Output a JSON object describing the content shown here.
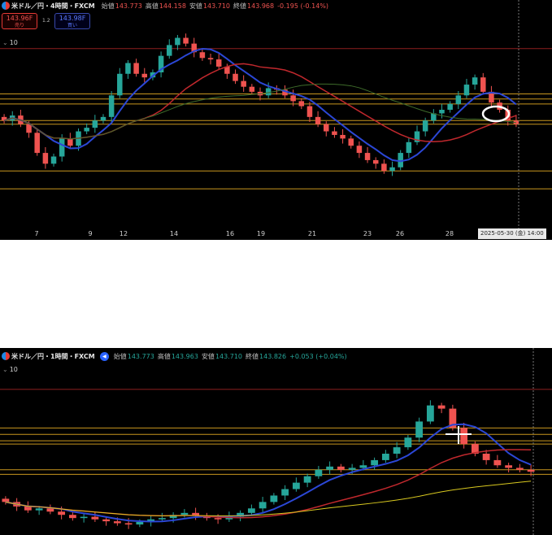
{
  "top_chart": {
    "symbol": "米ドル／円・4時間・FXCM",
    "ohlc": [
      {
        "label": "始値",
        "value": "143.773"
      },
      {
        "label": "高値",
        "value": "144.158"
      },
      {
        "label": "安値",
        "value": "143.710"
      },
      {
        "label": "終値",
        "value": "143.968"
      }
    ],
    "change": "-0.195 (-0.14%)",
    "sell_price": "143.96F",
    "sell_label": "売り",
    "spread": "1.2",
    "buy_price": "143.98F",
    "buy_label": "買い",
    "volume_label": "10",
    "date_tag": "2025-05-30 (金)   14:00",
    "x_ticks": [
      "7",
      "9",
      "12",
      "14",
      "16",
      "19",
      "21",
      "23",
      "26",
      "28"
    ]
  },
  "bottom_chart": {
    "symbol": "米ドル／円・1時間・FXCM",
    "ohlc": [
      {
        "label": "始値",
        "value": "143.773"
      },
      {
        "label": "高値",
        "value": "143.963"
      },
      {
        "label": "安値",
        "value": "143.710"
      },
      {
        "label": "終値",
        "value": "143.826"
      }
    ],
    "change": "+0.053 (+0.04%)",
    "volume_label": "10"
  },
  "colors": {
    "up": "#26a69a",
    "down": "#ef5350",
    "ma_short": "#2b47d6",
    "ma_mid": "#c0282d",
    "ma_long": "#3e6b2a",
    "ma_yellow": "#d8c81f",
    "hline_orange": "#c8961e",
    "hline_red": "#8e1f1f"
  },
  "chart_data": [
    {
      "type": "candlestick",
      "title": "米ドル／円・4時間・FXCM",
      "x_ticks": [
        "7",
        "9",
        "12",
        "14",
        "16",
        "19",
        "21",
        "23",
        "26",
        "28"
      ],
      "ylim": [
        142.4,
        145.0
      ],
      "close": [
        143.55,
        143.62,
        143.5,
        143.38,
        143.1,
        142.95,
        143.05,
        143.3,
        143.2,
        143.4,
        143.45,
        143.55,
        143.6,
        143.9,
        144.2,
        144.35,
        144.2,
        144.15,
        144.22,
        144.45,
        144.6,
        144.7,
        144.62,
        144.5,
        144.42,
        144.4,
        144.3,
        144.2,
        144.1,
        144.02,
        143.95,
        143.9,
        144.0,
        143.98,
        143.9,
        143.82,
        143.75,
        143.6,
        143.5,
        143.4,
        143.35,
        143.3,
        143.2,
        143.1,
        143.0,
        142.95,
        142.85,
        142.9,
        143.1,
        143.25,
        143.4,
        143.55,
        143.65,
        143.7,
        143.78,
        143.9,
        144.05,
        144.15,
        143.95,
        143.8,
        143.7,
        143.55,
        143.5
      ],
      "horizontal_levels": [
        144.55,
        143.92,
        143.85,
        143.78,
        143.55,
        143.5,
        142.85,
        142.6
      ],
      "annotation": "circle at recent high"
    },
    {
      "type": "candlestick",
      "title": "米ドル／円・1時間・FXCM",
      "ylim": [
        142.6,
        145.0
      ],
      "close": [
        143.05,
        142.98,
        142.92,
        142.95,
        142.9,
        142.85,
        142.8,
        142.82,
        142.78,
        142.75,
        142.72,
        142.7,
        142.74,
        142.78,
        142.8,
        142.85,
        142.88,
        142.84,
        142.8,
        142.78,
        142.82,
        142.88,
        142.95,
        143.05,
        143.15,
        143.25,
        143.35,
        143.45,
        143.55,
        143.6,
        143.55,
        143.58,
        143.62,
        143.7,
        143.8,
        143.9,
        144.05,
        144.3,
        144.55,
        144.5,
        144.2,
        143.95,
        143.8,
        143.7,
        143.62,
        143.58,
        143.55,
        143.52
      ],
      "horizontal_levels": [
        144.8,
        144.2,
        144.1,
        144.0,
        143.95,
        143.55,
        143.48
      ]
    }
  ]
}
